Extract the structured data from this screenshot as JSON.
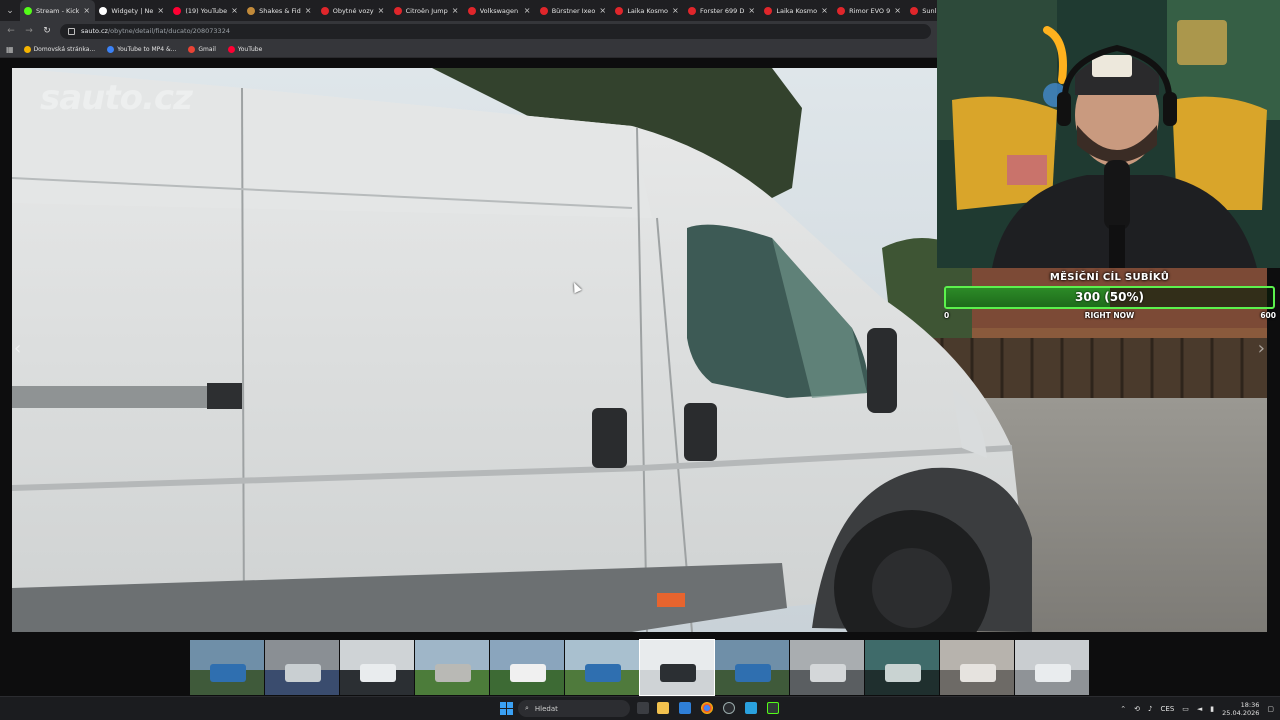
{
  "browser": {
    "tabs": [
      {
        "title": "Stream - Kick",
        "color": "#53fc18",
        "active": true
      },
      {
        "title": "Widgety | Ne",
        "color": "#ffffff",
        "active": false
      },
      {
        "title": "(19) YouTube",
        "color": "#ff0033",
        "active": false
      },
      {
        "title": "Shakes & Fid",
        "color": "#c28a3a",
        "active": false
      },
      {
        "title": "Obytné vozy",
        "color": "#e0262b",
        "active": false
      },
      {
        "title": "Citroën Jump",
        "color": "#e0262b",
        "active": false
      },
      {
        "title": "Volkswagen",
        "color": "#e0262b",
        "active": false
      },
      {
        "title": "Bürstner Ixeo",
        "color": "#e0262b",
        "active": false
      },
      {
        "title": "Laika Kosmo",
        "color": "#e0262b",
        "active": false
      },
      {
        "title": "Forster 699 D",
        "color": "#e0262b",
        "active": false
      },
      {
        "title": "Laika Kosmo",
        "color": "#e0262b",
        "active": false
      },
      {
        "title": "Rimor EVO 9",
        "color": "#e0262b",
        "active": false
      },
      {
        "title": "Sunlight Ostl",
        "color": "#e0262b",
        "active": false
      }
    ],
    "tab_close": "×",
    "url_host": "sauto.cz",
    "url_path": "/obytne/detail/fiat/ducato/208073324",
    "nav": {
      "back": "←",
      "forward": "→",
      "reload": "↻"
    },
    "bookmarks": [
      {
        "label": "Domovská stránka...",
        "color": "#f5b400"
      },
      {
        "label": "YouTube to MP4 &...",
        "color": "#3b82f6"
      },
      {
        "label": "Gmail",
        "color": "#ea4335"
      },
      {
        "label": "YouTube",
        "color": "#ff0033"
      }
    ]
  },
  "listing": {
    "watermark": "sauto.cz",
    "prev_arrow": "‹",
    "next_arrow": "›",
    "thumbnail_count": 12
  },
  "goal": {
    "title": "MĚSÍČNÍ CÍL SUBÍKŮ",
    "value_text": "300 (50%)",
    "progress": 0.5,
    "min": "0",
    "max": "600",
    "status": "RIGHT NOW",
    "accent": "#5cf24d"
  },
  "taskbar": {
    "search_label": "Hledat",
    "language": "CES",
    "time": "18:36",
    "date": "25.04.2026"
  }
}
